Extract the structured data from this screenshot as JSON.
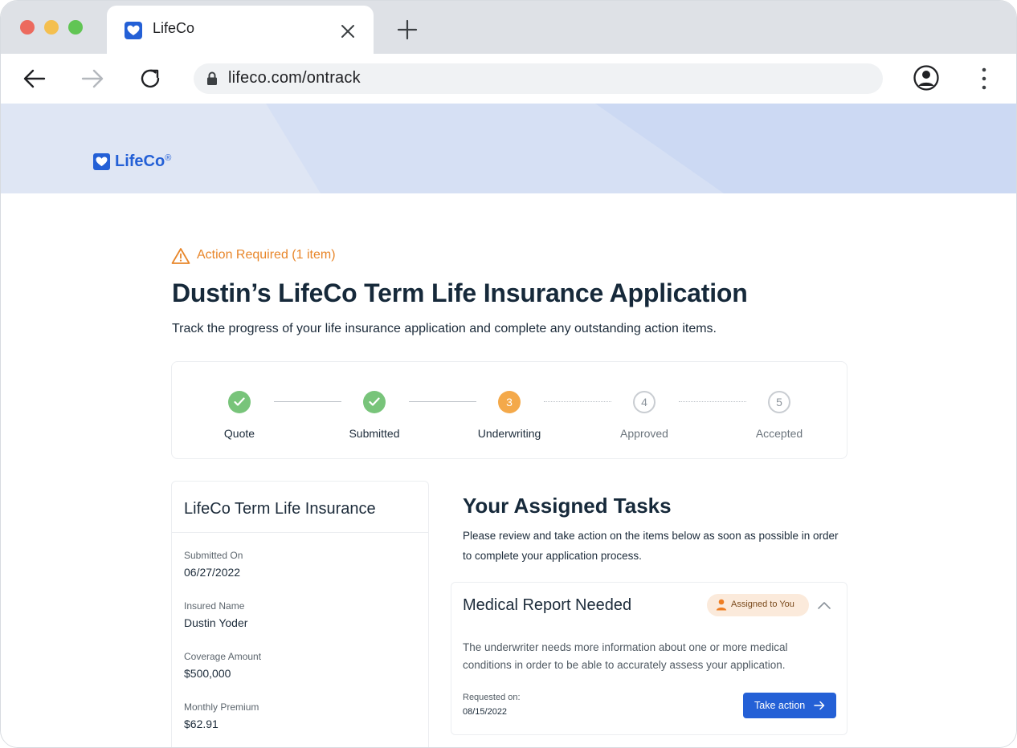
{
  "browser": {
    "tab_title": "LifeCo",
    "url": "lifeco.com/ontrack"
  },
  "brand": {
    "name": "LifeCo",
    "reg_mark": "®",
    "color": "#2460d6"
  },
  "alert": {
    "text": "Action Required (1 item)",
    "color": "#e8862a"
  },
  "page": {
    "title": "Dustin’s LifeCo Term Life Insurance Application",
    "subtitle": "Track the progress of your life insurance application and complete any outstanding action items."
  },
  "stepper": {
    "steps": [
      {
        "number": "1",
        "label": "Quote",
        "status": "done"
      },
      {
        "number": "2",
        "label": "Submitted",
        "status": "done"
      },
      {
        "number": "3",
        "label": "Underwriting",
        "status": "current"
      },
      {
        "number": "4",
        "label": "Approved",
        "status": "future"
      },
      {
        "number": "5",
        "label": "Accepted",
        "status": "future"
      }
    ],
    "colors": {
      "done": "#78c47a",
      "current": "#f4a94a",
      "future": "#c9cdd2"
    }
  },
  "policy": {
    "title": "LifeCo Term Life Insurance",
    "fields": [
      {
        "label": "Submitted On",
        "value": "06/27/2022"
      },
      {
        "label": "Insured Name",
        "value": "Dustin Yoder"
      },
      {
        "label": "Coverage Amount",
        "value": "$500,000"
      },
      {
        "label": "Monthly Premium",
        "value": "$62.91"
      }
    ]
  },
  "tasks": {
    "title": "Your Assigned Tasks",
    "description": "Please review and take action on the items below as soon as possible in order to complete your application process.",
    "items": [
      {
        "title": "Medical Report Needed",
        "badge": "Assigned to You",
        "description": "The underwriter needs more information about one or more medical conditions in order to be able to accurately assess your application.",
        "requested_label": "Requested on:",
        "requested_value": "08/15/2022",
        "action_label": "Take action"
      }
    ]
  }
}
